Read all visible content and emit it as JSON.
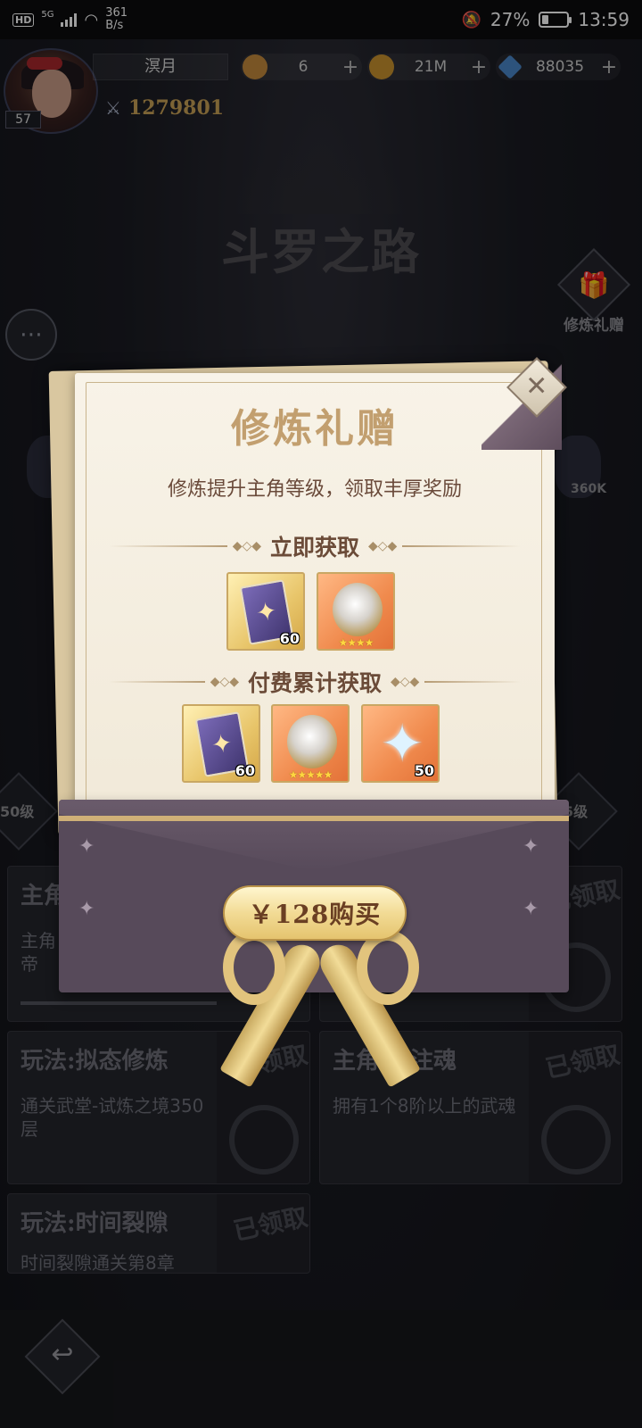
{
  "status_bar": {
    "hd": "HD",
    "net": "5G",
    "speed_value": "361",
    "speed_unit": "B/s",
    "battery_percent": "27%",
    "battery_level": 0.27,
    "time": "13:59"
  },
  "player": {
    "level": "57",
    "name": "溟月",
    "power": "1279801"
  },
  "resources": [
    {
      "icon": "token-icon",
      "value": "6",
      "color": "#c48a3c"
    },
    {
      "icon": "gold-coin-icon",
      "value": "21M",
      "color": "#c9922e"
    },
    {
      "icon": "diamond-icon",
      "value": "88035",
      "color": "#4a86c8"
    }
  ],
  "background": {
    "page_title": "斗罗之路",
    "gift_label": "修炼礼赠",
    "side_value": "360K",
    "level_left": "50级",
    "level_right": "5级",
    "tasks": [
      {
        "title": "主角",
        "desc": "主角\n帝",
        "stamp": "已领取"
      },
      {
        "title": "玩法:拟态修炼",
        "desc": "通关武堂-试炼之境350层",
        "stamp": "已领取"
      },
      {
        "title": "主角   魂注魂",
        "desc": "拥有1个8阶以上的武魂",
        "stamp": "已领取"
      },
      {
        "title": "玩法:时间裂隙",
        "desc": "时间裂隙通关第8章",
        "stamp": "已领取"
      }
    ]
  },
  "modal": {
    "title": "修炼礼赠",
    "subtitle": "修炼提升主角等级，领取丰厚奖励",
    "section_instant": "立即获取",
    "section_paid": "付费累计获取",
    "instant_items": [
      {
        "icon": "card-icon",
        "count": "60",
        "bg": "gold"
      },
      {
        "icon": "orb-icon",
        "stars": "★★★★",
        "bg": "orange"
      }
    ],
    "paid_items": [
      {
        "icon": "card-icon",
        "count": "60",
        "bg": "gold"
      },
      {
        "icon": "orb-icon",
        "stars": "★★★★★",
        "bg": "orange"
      },
      {
        "icon": "crystal-icon",
        "count": "50",
        "bg": "orange"
      }
    ],
    "buy_label": "￥128购买",
    "close_glyph": "✕"
  }
}
